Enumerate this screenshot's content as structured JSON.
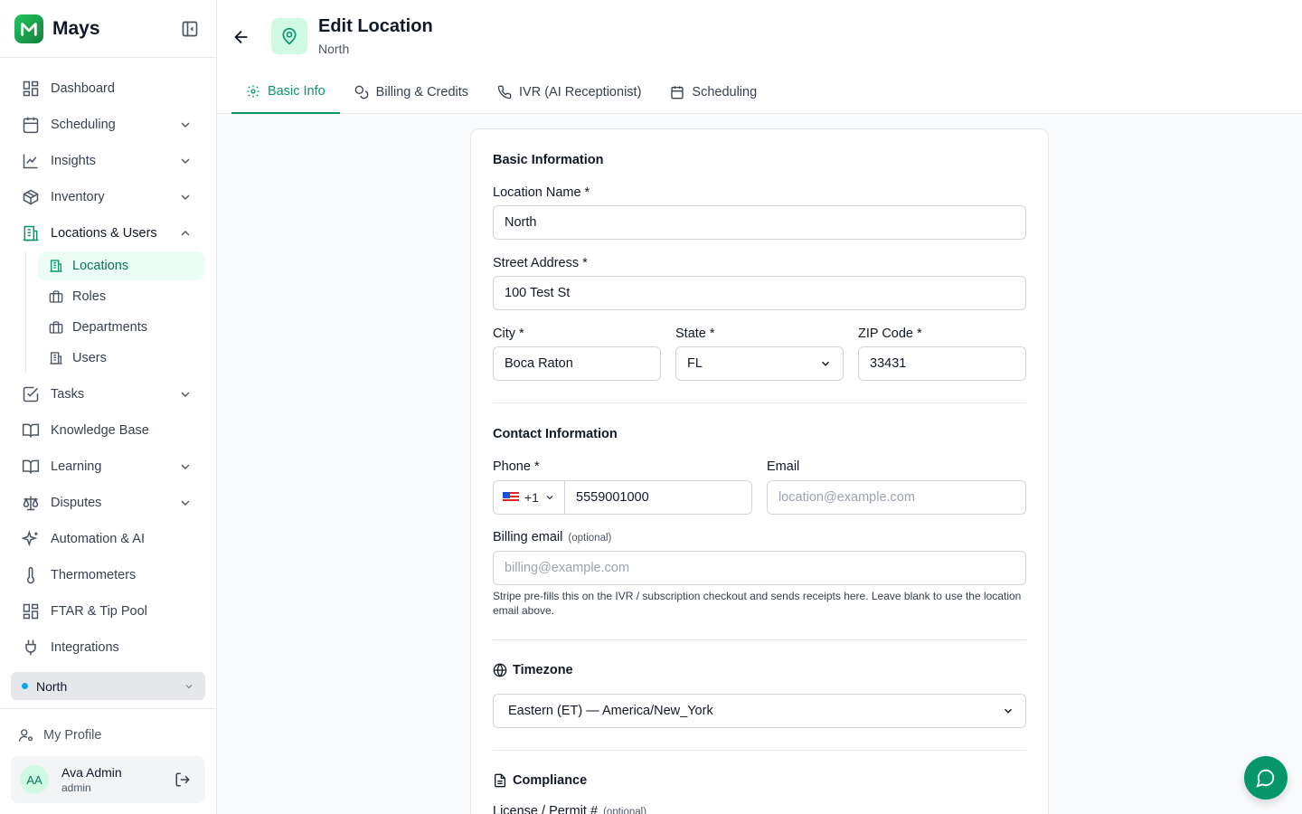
{
  "app": {
    "name": "Mays"
  },
  "sidebar": {
    "items": [
      {
        "label": "Dashboard"
      },
      {
        "label": "Scheduling"
      },
      {
        "label": "Insights"
      },
      {
        "label": "Inventory"
      },
      {
        "label": "Locations & Users"
      },
      {
        "label": "Tasks"
      },
      {
        "label": "Knowledge Base"
      },
      {
        "label": "Learning"
      },
      {
        "label": "Disputes"
      },
      {
        "label": "Automation & AI"
      },
      {
        "label": "Thermometers"
      },
      {
        "label": "FTAR & Tip Pool"
      },
      {
        "label": "Integrations"
      }
    ],
    "sub_items": [
      {
        "label": "Locations"
      },
      {
        "label": "Roles"
      },
      {
        "label": "Departments"
      },
      {
        "label": "Users"
      }
    ],
    "location_selector": "North",
    "my_profile": "My Profile",
    "user": {
      "initials": "AA",
      "name": "Ava Admin",
      "role": "admin"
    }
  },
  "header": {
    "title": "Edit Location",
    "subtitle": "North",
    "tabs": [
      {
        "label": "Basic Info"
      },
      {
        "label": "Billing & Credits"
      },
      {
        "label": "IVR (AI Receptionist)"
      },
      {
        "label": "Scheduling"
      }
    ]
  },
  "form": {
    "basic_title": "Basic Information",
    "location_name_label": "Location Name *",
    "location_name": "North",
    "street_label": "Street Address *",
    "street": "100 Test St",
    "city_label": "City *",
    "city": "Boca Raton",
    "state_label": "State *",
    "state": "FL",
    "zip_label": "ZIP Code *",
    "zip": "33431",
    "contact_title": "Contact Information",
    "phone_label": "Phone *",
    "country_code": "+1",
    "phone": "5559001000",
    "email_label": "Email",
    "email_placeholder": "location@example.com",
    "billing_label": "Billing email",
    "billing_optional": "(optional)",
    "billing_placeholder": "billing@example.com",
    "billing_help": "Stripe pre-fills this on the IVR / subscription checkout and sends receipts here. Leave blank to use the location email above.",
    "timezone_title": "Timezone",
    "timezone": "Eastern (ET) — America/New_York",
    "compliance_title": "Compliance",
    "license_label": "License / Permit #",
    "license_optional": "(optional)"
  },
  "colors": {
    "accent": "#059669",
    "accent_bg": "#ecfdf5"
  }
}
